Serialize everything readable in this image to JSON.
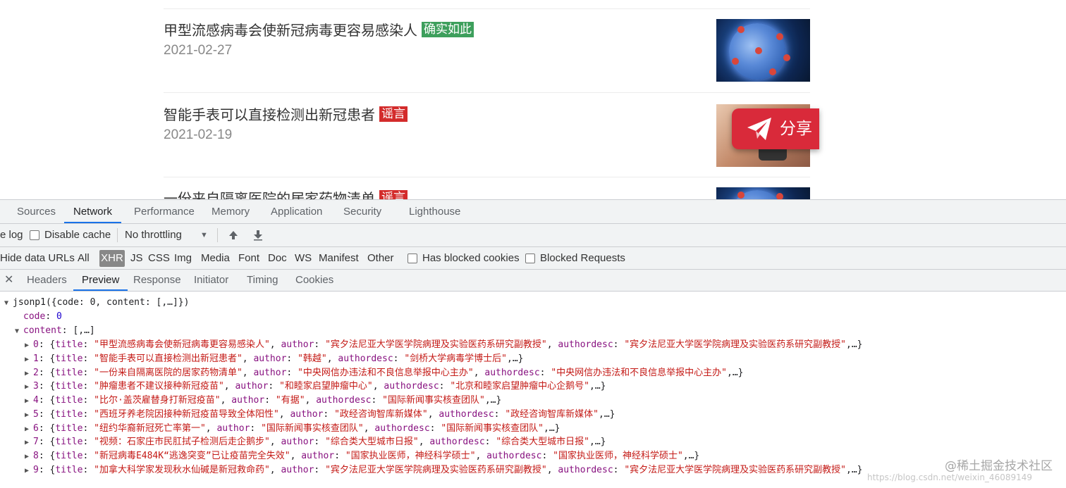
{
  "webpage": {
    "items": [
      {
        "title": "甲型流感病毒会使新冠病毒更容易感染人",
        "tag": "确实如此",
        "tag_type": "true",
        "date": "2021-02-27",
        "thumb": "virus-image"
      },
      {
        "title": "智能手表可以直接检测出新冠患者",
        "tag": "谣言",
        "tag_type": "rumor",
        "date": "2021-02-19",
        "thumb": "hand-watch-image"
      },
      {
        "title": "一份来自隔离医院的居家药物清单",
        "tag": "谣言",
        "tag_type": "rumor",
        "date": "",
        "thumb": "virus-image"
      }
    ],
    "share_button_label": "分享"
  },
  "devtools": {
    "panel_tabs": [
      "Sources",
      "Network",
      "Performance",
      "Memory",
      "Application",
      "Security",
      "Lighthouse"
    ],
    "active_panel": "Network",
    "toolbar": {
      "preserve_log_partial": "e log",
      "disable_cache": "Disable cache",
      "throttling": "No throttling"
    },
    "filter_bar": {
      "hide_data_urls": "Hide data URLs",
      "types": [
        "All",
        "XHR",
        "JS",
        "CSS",
        "Img",
        "Media",
        "Font",
        "Doc",
        "WS",
        "Manifest",
        "Other"
      ],
      "active_type": "XHR",
      "has_blocked_cookies": "Has blocked cookies",
      "blocked_requests": "Blocked Requests"
    },
    "sub_tabs": [
      "Headers",
      "Preview",
      "Response",
      "Initiator",
      "Timing",
      "Cookies"
    ],
    "active_sub_tab": "Preview",
    "preview": {
      "root": "jsonp1({code: 0, content: [,…]})",
      "code_key": "code",
      "code_value": "0",
      "content_key": "content",
      "content_summary": "[,…]",
      "rows": [
        {
          "index": "0",
          "title": "甲型流感病毒会使新冠病毒更容易感染人",
          "author": "宾夕法尼亚大学医学院病理及实验医药系研究副教授",
          "authordesc": "宾夕法尼亚大学医学院病理及实验医药系研究副教授"
        },
        {
          "index": "1",
          "title": "智能手表可以直接检测出新冠患者",
          "author": "韩越",
          "authordesc": "剑桥大学病毒学博士后"
        },
        {
          "index": "2",
          "title": "一份来自隔离医院的居家药物清单",
          "author": "中央网信办违法和不良信息举报中心主办",
          "authordesc": "中央网信办违法和不良信息举报中心主办"
        },
        {
          "index": "3",
          "title": "肿瘤患者不建议接种新冠疫苗",
          "author": "和睦家启望肿瘤中心",
          "authordesc": "北京和睦家启望肿瘤中心企鹅号"
        },
        {
          "index": "4",
          "title": "比尔·盖茨雇替身打新冠疫苗",
          "author": "有据",
          "authordesc": "国际新闻事实核查团队"
        },
        {
          "index": "5",
          "title": "西班牙养老院因接种新冠疫苗导致全体阳性",
          "author": "政经咨询智库新媒体",
          "authordesc": "政经咨询智库新媒体"
        },
        {
          "index": "6",
          "title": "纽约华裔新冠死亡率第一",
          "author": "国际新闻事实核查团队",
          "authordesc": "国际新闻事实核查团队"
        },
        {
          "index": "7",
          "title": "视频：石家庄市民肛拭子检测后走企鹅步",
          "author": "综合类大型城市日报",
          "authordesc": "综合类大型城市日报"
        },
        {
          "index": "8",
          "title": "新冠病毒E484K“逃逸突变”已让疫苗完全失效",
          "author": "国家执业医师，神经科学硕士",
          "authordesc": "国家执业医师，神经科学硕士"
        },
        {
          "index": "9",
          "title": "加拿大科学家发现秋水仙碱是新冠救命药",
          "author": "宾夕法尼亚大学医学院病理及实验医药系研究副教授",
          "authordesc": "宾夕法尼亚大学医学院病理及实验医药系研究副教授"
        }
      ]
    }
  },
  "watermark": "@稀土掘金技术社区",
  "watermark_url": "https://blog.csdn.net/weixin_46089149"
}
